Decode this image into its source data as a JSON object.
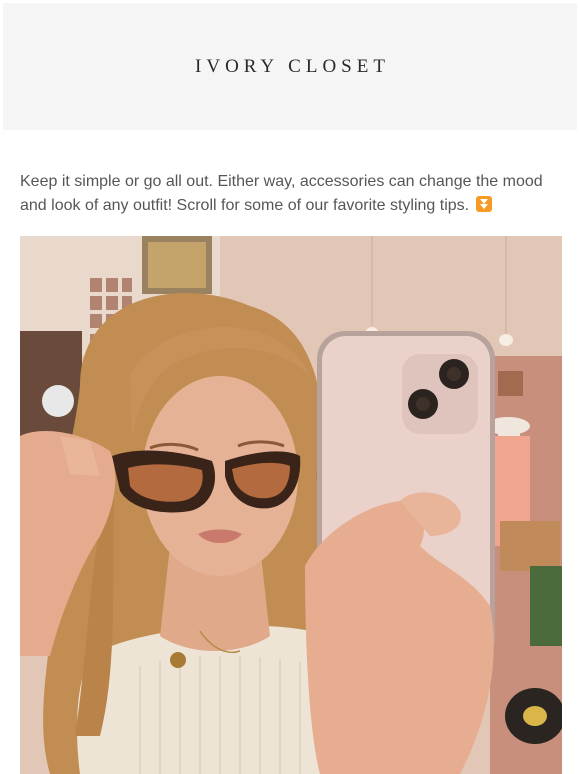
{
  "header": {
    "brand": "IVORY CLOSET"
  },
  "intro": {
    "text": "Keep it simple or go all out. Either way, accessories can change the mood and look of any outfit! Scroll for some of our favorite styling tips.",
    "emoji_icon": "double-down-arrow-icon"
  },
  "photo": {
    "subject": "mirror-selfie-photo",
    "colors": {
      "wall": "#e6cbbb",
      "hair": "#c9955a",
      "skin": "#e2ae91",
      "phone": "#e9cfc8",
      "sunglass_lens": "#b46a3f",
      "shirt": "#efe6d9"
    }
  }
}
